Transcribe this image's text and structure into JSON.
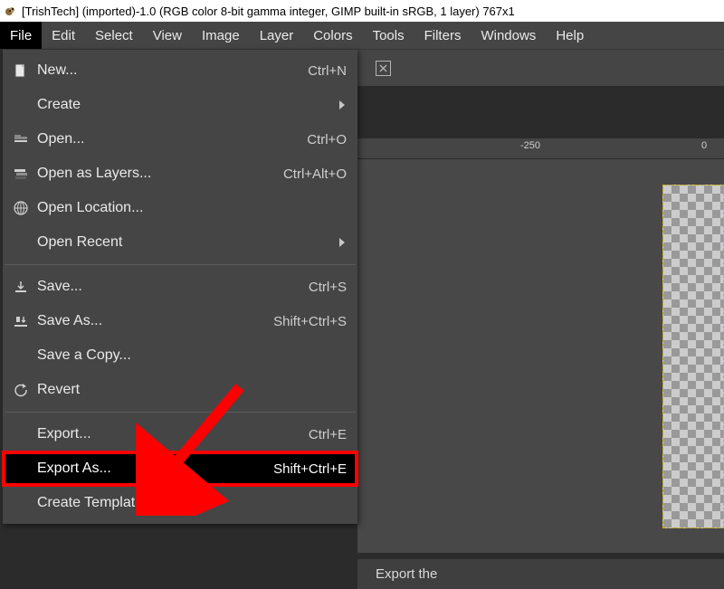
{
  "title": "[TrishTech] (imported)-1.0 (RGB color 8-bit gamma integer, GIMP built-in sRGB, 1 layer) 767x1",
  "menubar": {
    "file": "File",
    "edit": "Edit",
    "select": "Select",
    "view": "View",
    "image": "Image",
    "layer": "Layer",
    "colors": "Colors",
    "tools": "Tools",
    "filters": "Filters",
    "windows": "Windows",
    "help": "Help"
  },
  "file_menu": {
    "new_": {
      "label": "New...",
      "shortcut": "Ctrl+N"
    },
    "create": {
      "label": "Create"
    },
    "open": {
      "label": "Open...",
      "shortcut": "Ctrl+O"
    },
    "open_as_layers": {
      "label": "Open as Layers...",
      "shortcut": "Ctrl+Alt+O"
    },
    "open_location": {
      "label": "Open Location..."
    },
    "open_recent": {
      "label": "Open Recent"
    },
    "save": {
      "label": "Save...",
      "shortcut": "Ctrl+S"
    },
    "save_as": {
      "label": "Save As...",
      "shortcut": "Shift+Ctrl+S"
    },
    "save_copy": {
      "label": "Save a Copy..."
    },
    "revert": {
      "label": "Revert"
    },
    "export": {
      "label": "Export...",
      "shortcut": "Ctrl+E"
    },
    "export_as": {
      "label": "Export As...",
      "shortcut": "Shift+Ctrl+E"
    },
    "create_template": {
      "label": "Create Template..."
    }
  },
  "ruler": {
    "t1": "-250",
    "t2": "0"
  },
  "status": "Export the"
}
